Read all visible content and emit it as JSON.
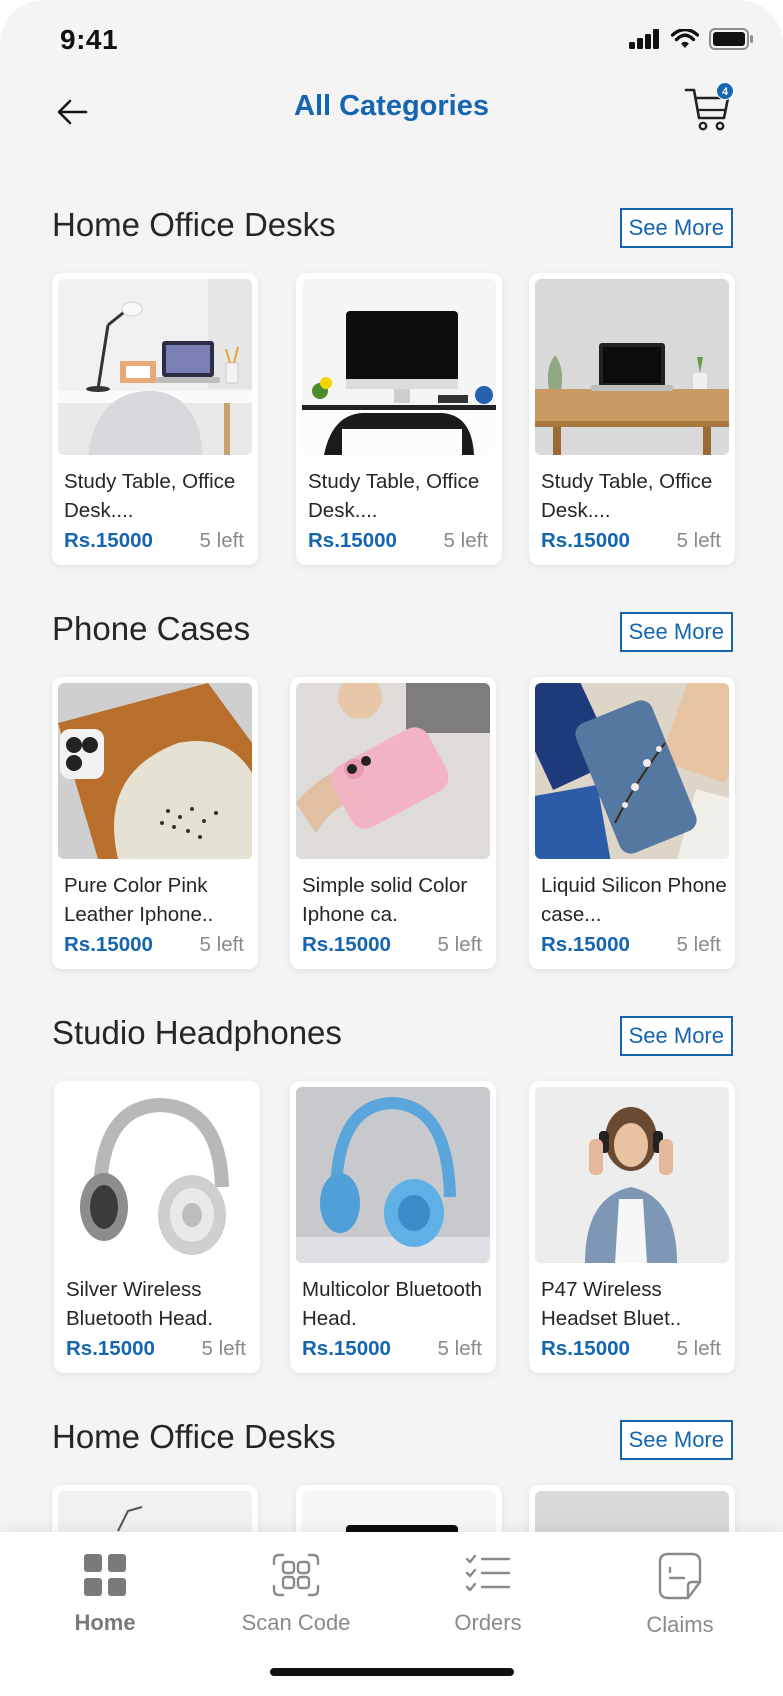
{
  "status_bar": {
    "time": "9:41"
  },
  "header": {
    "title": "All Categories",
    "cart_count": "4"
  },
  "sections": [
    {
      "title": "Home Office Desks",
      "see_more": "See More",
      "products": [
        {
          "name": "Study Table, Office Desk....",
          "price": "Rs.15000",
          "stock": "5 left",
          "image": "desk-lamp-laptop"
        },
        {
          "name": "Study Table, Office Desk....",
          "price": "Rs.15000",
          "stock": "5 left",
          "image": "desk-imac"
        },
        {
          "name": "Study Table, Office Desk....",
          "price": "Rs.15000",
          "stock": "5 left",
          "image": "desk-wooden-laptop"
        }
      ]
    },
    {
      "title": "Phone Cases",
      "see_more": "See More",
      "products": [
        {
          "name": "Pure Color Pink Leather Iphone..",
          "price": "Rs.15000",
          "stock": "5 left",
          "image": "case-brown-beige"
        },
        {
          "name": "Simple solid Color Iphone ca.",
          "price": "Rs.15000",
          "stock": "5 left",
          "image": "case-pink"
        },
        {
          "name": "Liquid Silicon Phone case...",
          "price": "Rs.15000",
          "stock": "5 left",
          "image": "case-floral-blue"
        }
      ]
    },
    {
      "title": "Studio Headphones",
      "see_more": "See More",
      "products": [
        {
          "name": "Silver Wireless Bluetooth Head.",
          "price": "Rs.15000",
          "stock": "5 left",
          "image": "headphones-silver"
        },
        {
          "name": "Multicolor Bluetooth Head.",
          "price": "Rs.15000",
          "stock": "5 left",
          "image": "headphones-blue"
        },
        {
          "name": "P47 Wireless Headset Bluet..",
          "price": "Rs.15000",
          "stock": "5 left",
          "image": "woman-headphones"
        }
      ]
    },
    {
      "title": "Home Office Desks",
      "see_more": "See More",
      "products": []
    }
  ],
  "bottom_nav": [
    {
      "label": "Home",
      "icon": "grid-icon",
      "active": true
    },
    {
      "label": "Scan Code",
      "icon": "scan-icon",
      "active": false
    },
    {
      "label": "Orders",
      "icon": "checklist-icon",
      "active": false
    },
    {
      "label": "Claims",
      "icon": "document-icon",
      "active": false
    }
  ],
  "colors": {
    "accent": "#1565b0",
    "muted": "#8a8a8a",
    "background": "#f4f4f5"
  }
}
